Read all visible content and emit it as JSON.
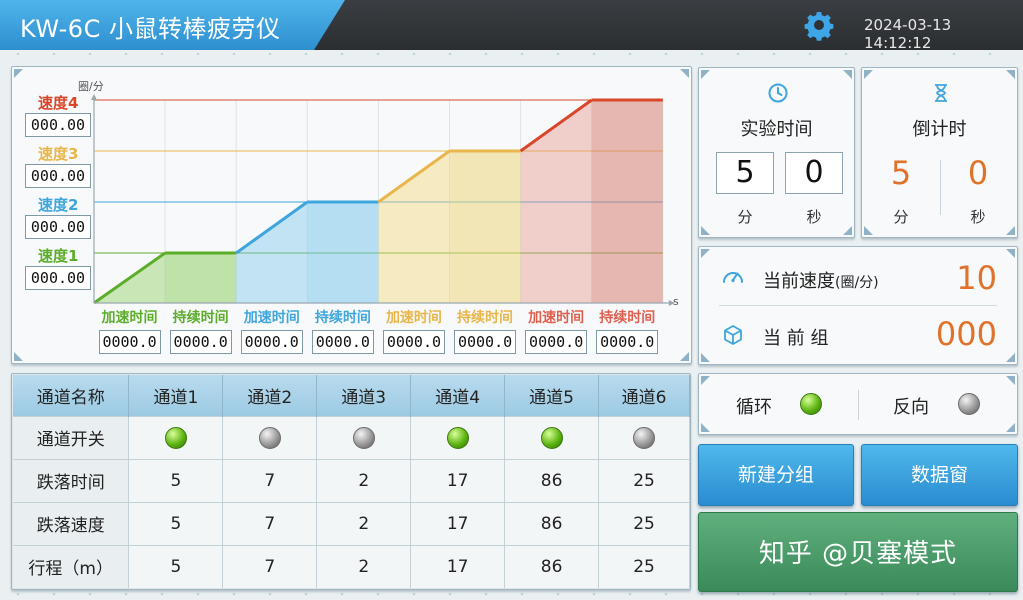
{
  "header": {
    "title": "KW-6C 小鼠转棒疲劳仪",
    "datetime": "2024-03-13 14:12:12",
    "settings_icon": "gear-icon",
    "accent": "#3aa3e0"
  },
  "chart": {
    "y_unit": "圈/分",
    "x_unit": "s",
    "speeds": [
      {
        "label": "速度4",
        "value": "000.00",
        "color": "#d9472b"
      },
      {
        "label": "速度3",
        "value": "000.00",
        "color": "#e8b64a"
      },
      {
        "label": "速度2",
        "value": "000.00",
        "color": "#3ea6dc"
      },
      {
        "label": "速度1",
        "value": "000.00",
        "color": "#5cad2a"
      }
    ],
    "segments": [
      {
        "label": "加速时间",
        "value": "0000.0",
        "color": "#5cad2a"
      },
      {
        "label": "持续时间",
        "value": "0000.0",
        "color": "#5cad2a"
      },
      {
        "label": "加速时间",
        "value": "0000.0",
        "color": "#3ea6dc"
      },
      {
        "label": "持续时间",
        "value": "0000.0",
        "color": "#3ea6dc"
      },
      {
        "label": "加速时间",
        "value": "0000.0",
        "color": "#e8b64a"
      },
      {
        "label": "持续时间",
        "value": "0000.0",
        "color": "#e8b64a"
      },
      {
        "label": "加速时间",
        "value": "0000.0",
        "color": "#e06050"
      },
      {
        "label": "持续时间",
        "value": "0000.0",
        "color": "#e06050"
      }
    ]
  },
  "experiment_time": {
    "title": "实验时间",
    "icon": "clock-icon",
    "minutes": "5",
    "seconds": "0",
    "min_unit": "分",
    "sec_unit": "秒"
  },
  "countdown": {
    "title": "倒计时",
    "icon": "hourglass-icon",
    "minutes": "5",
    "seconds": "0",
    "min_unit": "分",
    "sec_unit": "秒"
  },
  "status": {
    "speed_label": "当前速度",
    "speed_unit": "(圈/分)",
    "speed_value": "10",
    "group_label": "当 前 组",
    "group_value": "000",
    "speed_icon": "gauge-icon",
    "group_icon": "cube-icon"
  },
  "table": {
    "headers": [
      "通道名称",
      "通道1",
      "通道2",
      "通道3",
      "通道4",
      "通道5",
      "通道6"
    ],
    "switch_label": "通道开关",
    "switches": [
      true,
      false,
      false,
      true,
      true,
      false
    ],
    "rows": [
      {
        "label": "跌落时间",
        "values": [
          "5",
          "7",
          "2",
          "17",
          "86",
          "25"
        ]
      },
      {
        "label": "跌落速度",
        "values": [
          "5",
          "7",
          "2",
          "17",
          "86",
          "25"
        ]
      },
      {
        "label": "行程（m）",
        "values": [
          "5",
          "7",
          "2",
          "17",
          "86",
          "25"
        ]
      }
    ]
  },
  "loop": {
    "loop_label": "循环",
    "loop_on": true,
    "reverse_label": "反向",
    "reverse_on": false
  },
  "buttons": {
    "new_group": "新建分组",
    "data_window": "数据窗",
    "mode": "知乎 @贝塞模式"
  }
}
